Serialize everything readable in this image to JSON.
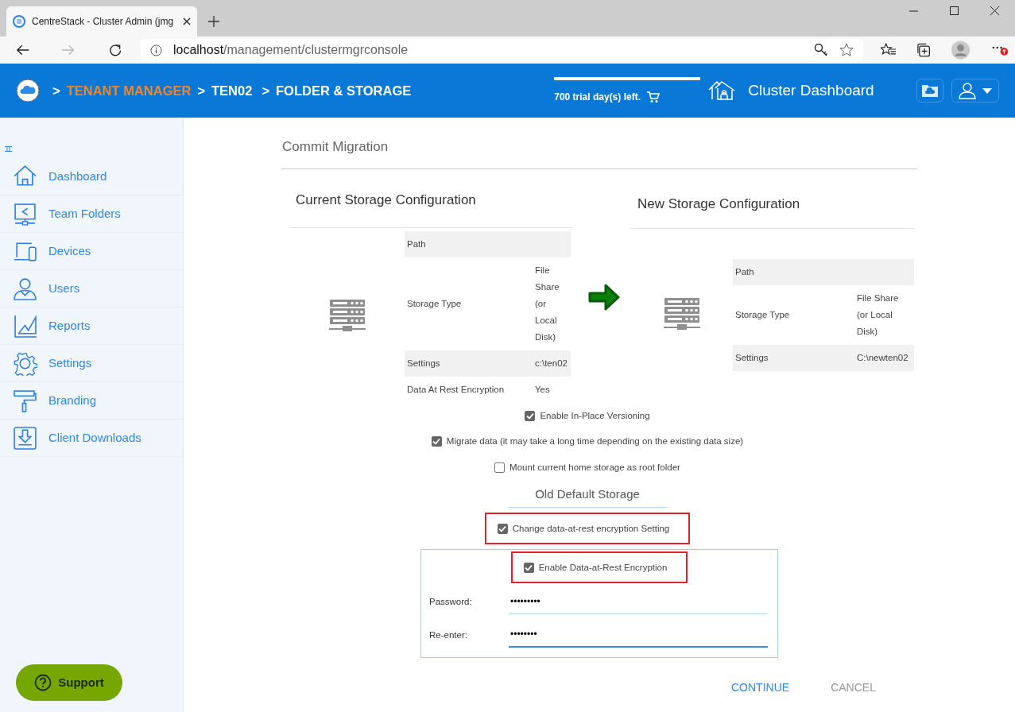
{
  "browser": {
    "tab_title": "CentreStack - Cluster Admin (jmg",
    "url_host": "localhost",
    "url_path": "/management/clustermgrconsole"
  },
  "header": {
    "breadcrumb": [
      {
        "separator": ">",
        "label": "TENANT MANAGER",
        "color": "#f0862a"
      },
      {
        "separator": ">",
        "label": "TEN02",
        "color": "#ffffff"
      },
      {
        "separator": ">",
        "label": "FOLDER & STORAGE",
        "color": "#ffffff"
      }
    ],
    "trial": "700 trial day(s) left.",
    "dashboard": "Cluster Dashboard"
  },
  "sidebar": {
    "items": [
      {
        "kind": "home",
        "label": "Dashboard"
      },
      {
        "kind": "share",
        "label": "Team Folders"
      },
      {
        "kind": "devices",
        "label": "Devices"
      },
      {
        "kind": "users",
        "label": "Users"
      },
      {
        "kind": "reports",
        "label": "Reports"
      },
      {
        "kind": "settings",
        "label": "Settings"
      },
      {
        "kind": "branding",
        "label": "Branding"
      },
      {
        "kind": "downloads",
        "label": "Client Downloads"
      }
    ],
    "support": "Support"
  },
  "main": {
    "title": "Commit Migration",
    "current": {
      "heading": "Current Storage Configuration",
      "rows": [
        {
          "label": "Path"
        },
        {
          "label": "Storage Type",
          "value": "File Share (or Local Disk)"
        },
        {
          "label": "Settings",
          "value": "c:\\ten02"
        },
        {
          "label": "Data At Rest Encryption",
          "value": "Yes"
        }
      ]
    },
    "new": {
      "heading": "New Storage Configuration",
      "rows": [
        {
          "label": "Path"
        },
        {
          "label": "Storage Type",
          "value": "File Share (or Local Disk)"
        },
        {
          "label": "Settings",
          "value": "C:\\newten02"
        }
      ]
    },
    "options": [
      {
        "label": "Enable In-Place Versioning",
        "checked": true
      },
      {
        "label": "Migrate data (it may take a long time depending on the existing data size)",
        "checked": true
      },
      {
        "label": "Mount current home storage as root folder",
        "checked": false
      }
    ],
    "old_default_storage": "Old Default Storage",
    "change_setting": {
      "label": "Change data-at-rest encryption Setting",
      "checked": true,
      "highlighted": true
    },
    "encryption": {
      "enable": {
        "label": "Enable Data-at-Rest Encryption",
        "checked": true,
        "highlighted": true
      },
      "fields": [
        {
          "label": "Password:",
          "value": "•••••••••",
          "focused": false
        },
        {
          "label": "Re-enter:",
          "value": "••••••••",
          "focused": true
        }
      ]
    },
    "buttons": [
      {
        "label": "CONTINUE",
        "kind": "primary"
      },
      {
        "label": "CANCEL",
        "kind": "secondary"
      }
    ]
  }
}
